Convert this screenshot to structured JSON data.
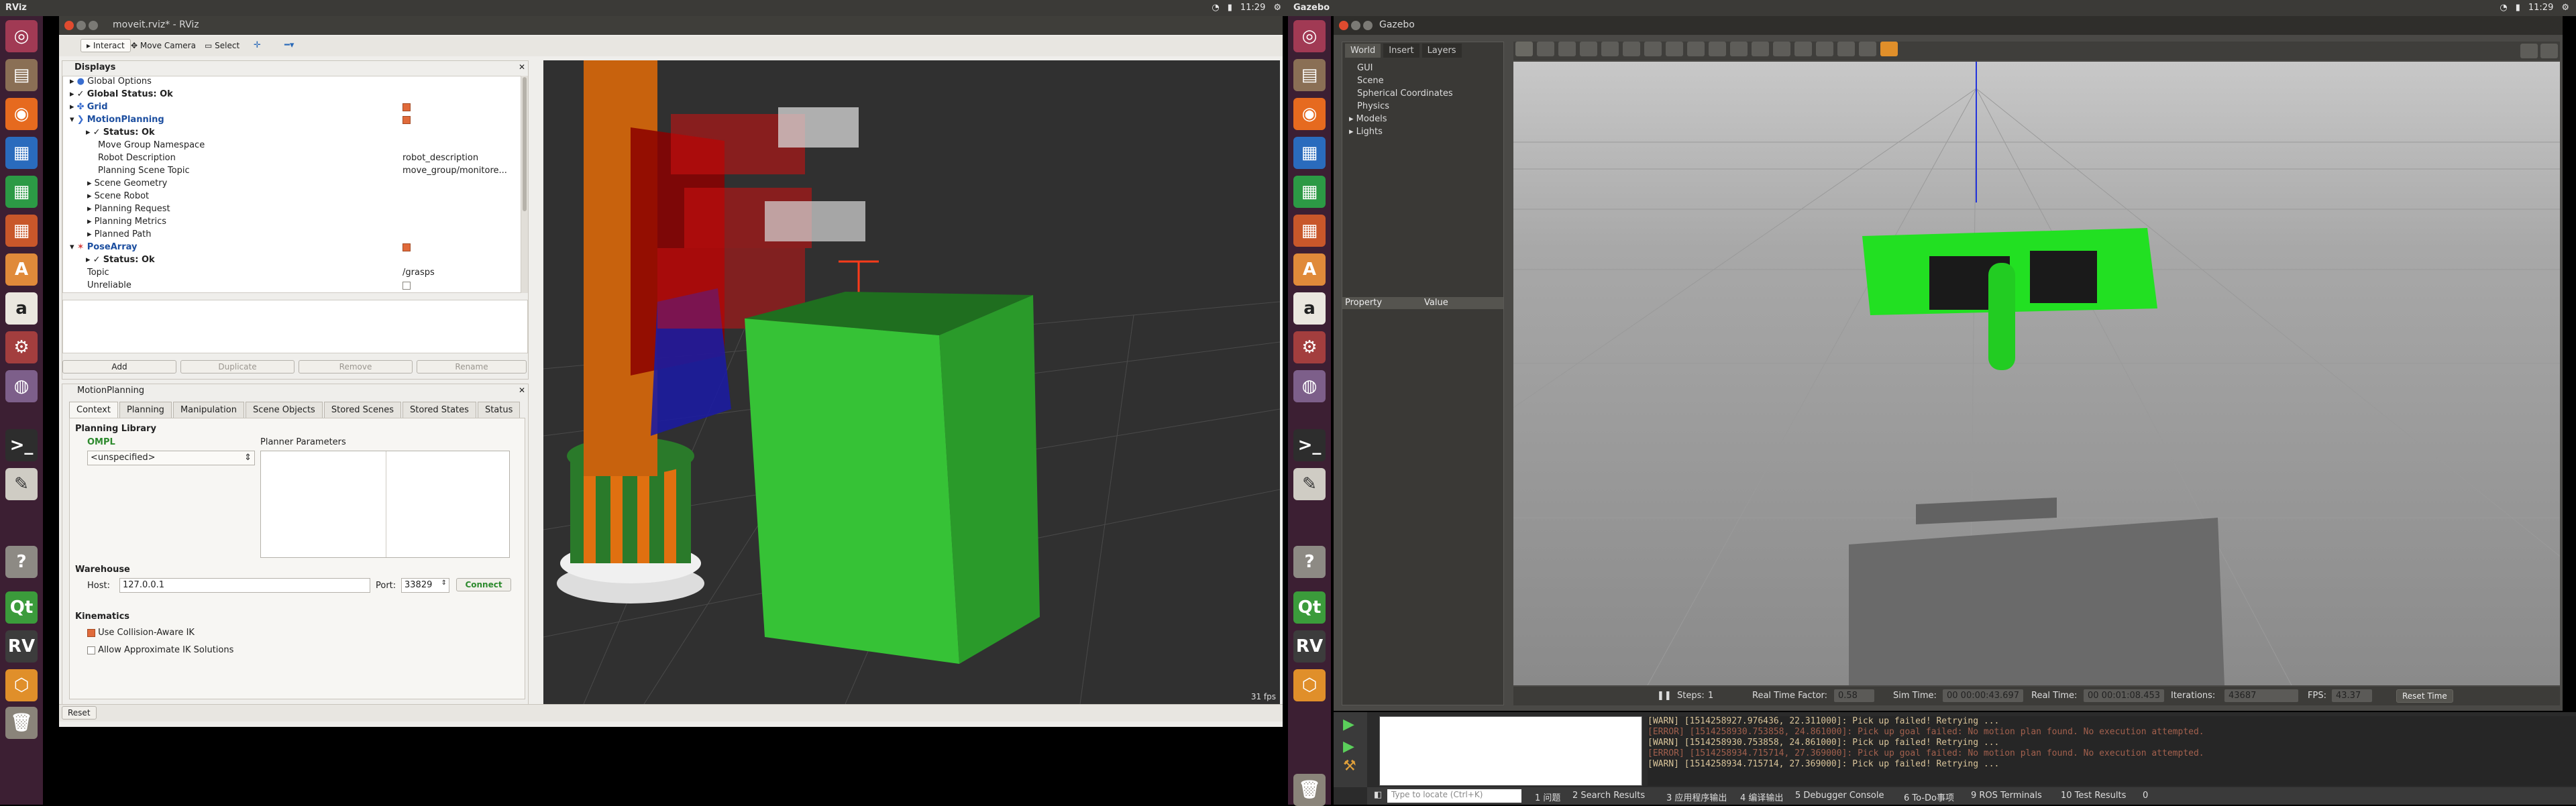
{
  "left_panel": {
    "title": "RViz",
    "clock": "11:29"
  },
  "right_panel": {
    "title": "Gazebo",
    "clock": "11:29"
  },
  "rviz": {
    "window_title": "moveit.rviz* - RViz",
    "toolbar": {
      "interact": "Interact",
      "move_camera": "Move Camera",
      "select": "Select"
    },
    "displays": {
      "header": "Displays",
      "rows": [
        {
          "label": "Global Options",
          "value": ""
        },
        {
          "label": "Global Status: Ok",
          "value": ""
        },
        {
          "label": "Grid",
          "value": ""
        },
        {
          "label": "MotionPlanning",
          "value": ""
        },
        {
          "label": "Status: Ok",
          "value": ""
        },
        {
          "label": "Move Group Namespace",
          "value": ""
        },
        {
          "label": "Robot Description",
          "value": "robot_description"
        },
        {
          "label": "Planning Scene Topic",
          "value": "move_group/monitore..."
        },
        {
          "label": "Scene Geometry",
          "value": ""
        },
        {
          "label": "Scene Robot",
          "value": ""
        },
        {
          "label": "Planning Request",
          "value": ""
        },
        {
          "label": "Planning Metrics",
          "value": ""
        },
        {
          "label": "Planned Path",
          "value": ""
        },
        {
          "label": "PoseArray",
          "value": ""
        },
        {
          "label": "Status: Ok",
          "value": ""
        },
        {
          "label": "Topic",
          "value": "/grasps"
        },
        {
          "label": "Unreliable",
          "value": ""
        }
      ],
      "buttons": {
        "add": "Add",
        "duplicate": "Duplicate",
        "remove": "Remove",
        "rename": "Rename"
      }
    },
    "motion_planning": {
      "header": "MotionPlanning",
      "tabs": [
        "Context",
        "Planning",
        "Manipulation",
        "Scene Objects",
        "Stored Scenes",
        "Stored States",
        "Status"
      ],
      "planning_library": "Planning Library",
      "library": "OMPL",
      "planner": "<unspecified>",
      "planner_params": "Planner Parameters",
      "warehouse": "Warehouse",
      "host_label": "Host:",
      "host": "127.0.0.1",
      "port_label": "Port:",
      "port": "33829",
      "connect": "Connect",
      "kinematics": "Kinematics",
      "collision_ik": "Use Collision-Aware IK",
      "approx_ik": "Allow Approximate IK Solutions"
    },
    "reset": "Reset",
    "fps": "31 fps"
  },
  "gazebo": {
    "window_title": "Gazebo",
    "tabs": [
      "World",
      "Insert",
      "Layers"
    ],
    "world_items": [
      "GUI",
      "Scene",
      "Spherical Coordinates",
      "Physics",
      "Models",
      "Lights"
    ],
    "prop_header": {
      "property": "Property",
      "value": "Value"
    },
    "status": {
      "steps_label": "Steps:",
      "steps": "1",
      "rtf_label": "Real Time Factor:",
      "rtf": "0.58",
      "sim_label": "Sim Time:",
      "sim": "00 00:00:43.697",
      "real_label": "Real Time:",
      "real": "00 00:01:08.453",
      "iter_label": "Iterations:",
      "iter": "43687",
      "fps_label": "FPS:",
      "fps": "43.37",
      "reset": "Reset Time"
    }
  },
  "console": {
    "lines": [
      "[WARN] [1514258927.976436, 22.311000]: Pick up failed! Retrying ...",
      "[ERROR] [1514258930.753858, 24.861000]: Pick up goal failed: No motion plan found. No execution attempted.",
      "[WARN] [1514258930.753858, 24.861000]: Pick up failed! Retrying ...",
      "[ERROR] [1514258934.715714, 27.369000]: Pick up goal failed: No motion plan found. No execution attempted.",
      "[WARN] [1514258934.715714, 27.369000]: Pick up failed! Retrying ..."
    ]
  },
  "ide_bar": {
    "search_placeholder": "Type to locate (Ctrl+K)",
    "items": [
      "1 问题",
      "2 Search Results",
      "3 应用程序输出",
      "4 编译输出",
      "5 Debugger Console",
      "6 To-Do事项",
      "9 ROS Terminals",
      "10 Test Results"
    ],
    "count": "0"
  }
}
